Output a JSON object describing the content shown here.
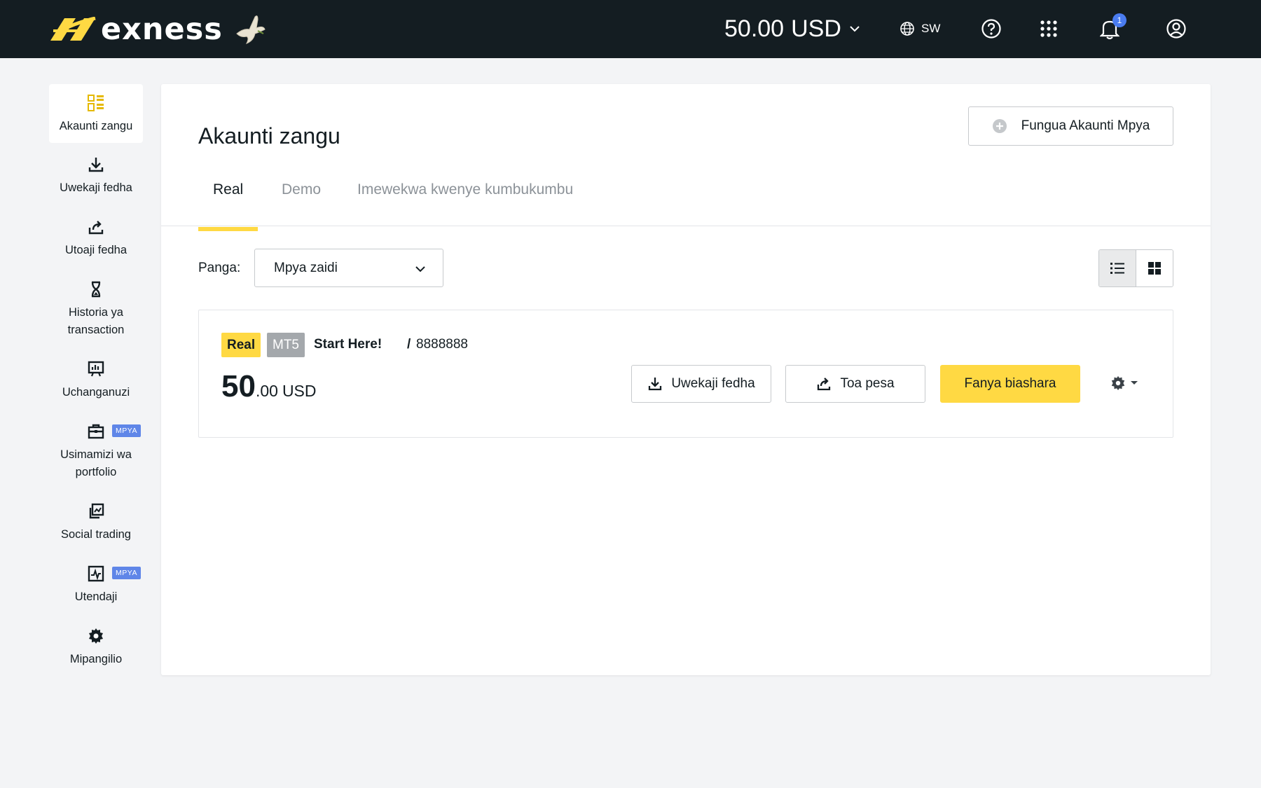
{
  "header": {
    "logo_text": "exness",
    "balance_amount": "50.00",
    "balance_currency": "USD",
    "language": "SW",
    "notification_count": "1",
    "icons": [
      "globe-icon",
      "help-icon",
      "apps-grid-icon",
      "bell-icon",
      "user-circle-icon"
    ]
  },
  "sidebar": {
    "items": [
      {
        "label": "Akaunti zangu",
        "icon": "dashboard-icon",
        "active": true
      },
      {
        "label": "Uwekaji fedha",
        "icon": "download-icon"
      },
      {
        "label": "Utoaji fedha",
        "icon": "share-out-icon"
      },
      {
        "label": "Historia ya transaction",
        "icon": "hourglass-icon"
      },
      {
        "label": "Uchanganuzi",
        "icon": "presentation-icon"
      },
      {
        "label": "Usimamizi wa portfolio",
        "icon": "briefcase-icon",
        "badge": "MPYA"
      },
      {
        "label": "Social trading",
        "icon": "copy-trade-icon"
      },
      {
        "label": "Utendaji",
        "icon": "performance-icon",
        "badge": "MPYA"
      },
      {
        "label": "Mipangilio",
        "icon": "gear-icon"
      }
    ]
  },
  "main": {
    "title": "Akaunti zangu",
    "new_account_label": "Fungua Akaunti Mpya",
    "tabs": [
      {
        "label": "Real",
        "active": true
      },
      {
        "label": "Demo"
      },
      {
        "label": "Imewekwa kwenye kumbukumbu"
      }
    ],
    "sort_label": "Panga:",
    "sort_value": "Mpya zaidi",
    "view_mode": "list"
  },
  "account": {
    "type_badge": "Real",
    "platform_badge": "MT5",
    "name": "Start Here!",
    "separator": "/",
    "number": "8888888",
    "balance_int": "50",
    "balance_dec": ".00",
    "currency": "USD",
    "deposit_label": "Uwekaji fedha",
    "withdraw_label": "Toa pesa",
    "trade_label": "Fanya biashara"
  },
  "colors": {
    "topbar": "#141d22",
    "accent_yellow": "#ffd943",
    "badge_blue": "#5f86e8",
    "mt5_grey": "#a4a8ac"
  }
}
